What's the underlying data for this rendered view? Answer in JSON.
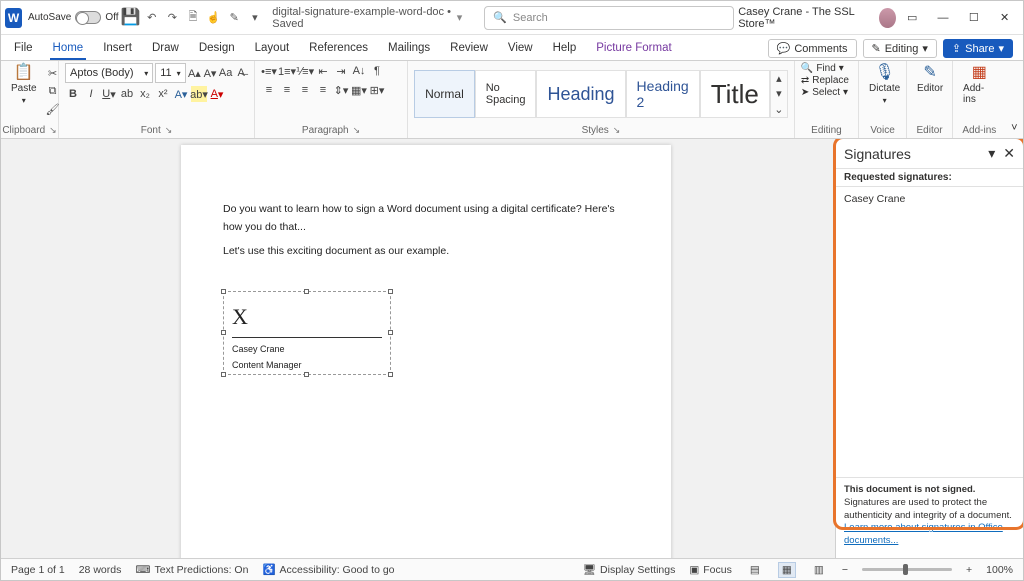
{
  "titlebar": {
    "autosave_label": "AutoSave",
    "autosave_state": "Off",
    "doc_title": "digital-signature-example-word-doc • Saved",
    "search_placeholder": "Search",
    "user_label": "Casey Crane - The SSL Store™"
  },
  "menu": {
    "tabs": [
      "File",
      "Home",
      "Insert",
      "Draw",
      "Design",
      "Layout",
      "References",
      "Mailings",
      "Review",
      "View",
      "Help",
      "Picture Format"
    ],
    "active": "Home",
    "comments": "Comments",
    "editing": "Editing",
    "share": "Share"
  },
  "ribbon": {
    "clipboard": {
      "paste": "Paste",
      "label": "Clipboard"
    },
    "font": {
      "name": "Aptos (Body)",
      "size": "11",
      "label": "Font"
    },
    "paragraph": {
      "label": "Paragraph"
    },
    "styles": {
      "items": [
        "Normal",
        "No Spacing",
        "Heading",
        "Heading 2",
        "Title"
      ],
      "label": "Styles"
    },
    "editing": {
      "find": "Find",
      "replace": "Replace",
      "select": "Select",
      "label": "Editing"
    },
    "voice": {
      "dictate": "Dictate",
      "label": "Voice"
    },
    "editor": {
      "editor": "Editor",
      "label": "Editor"
    },
    "addins": {
      "addins": "Add-ins",
      "label": "Add-ins"
    }
  },
  "document": {
    "para1": "Do you want to learn how to sign a Word document using a digital certificate? Here's how you do that...",
    "para2": "Let's use this exciting document as our example.",
    "sig_x": "X",
    "sig_name": "Casey Crane",
    "sig_role": "Content Manager"
  },
  "pane": {
    "title": "Signatures",
    "subtitle": "Requested signatures:",
    "name": "Casey Crane",
    "unsigned_bold": "This document is not signed.",
    "unsigned_body": "Signatures are used to protect the authenticity and integrity of a document.",
    "learn_more": "Learn more about signatures in Office documents..."
  },
  "status": {
    "page": "Page 1 of 1",
    "words": "28 words",
    "predictions": "Text Predictions: On",
    "accessibility": "Accessibility: Good to go",
    "display": "Display Settings",
    "focus": "Focus",
    "zoom": "100%"
  }
}
